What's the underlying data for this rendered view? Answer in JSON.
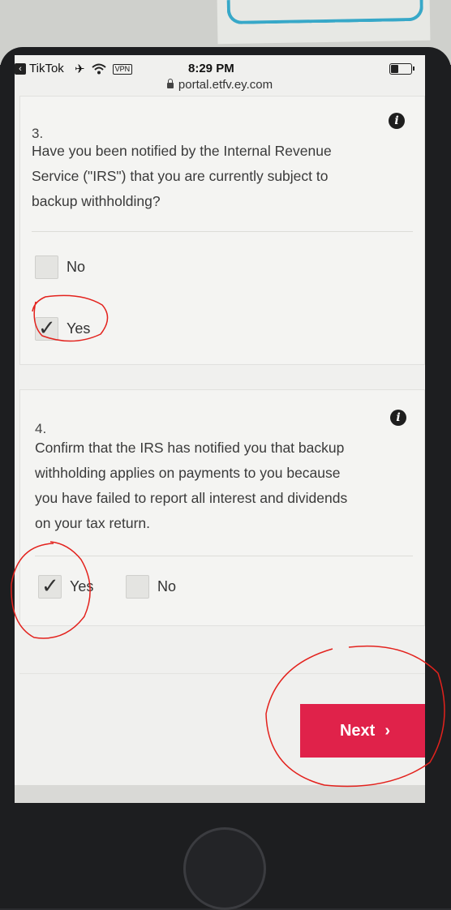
{
  "status_bar": {
    "back_app": "TikTok",
    "vpn": "VPN",
    "time": "8:29 PM"
  },
  "url": "portal.etfv.ey.com",
  "questions": [
    {
      "number": "3.",
      "text_lines": [
        "Have you been notified by the Internal Revenue",
        "Service (\"IRS\") that you are currently subject to",
        "backup withholding?"
      ],
      "options": [
        {
          "label": "No",
          "checked": false
        },
        {
          "label": "Yes",
          "checked": true
        }
      ]
    },
    {
      "number": "4.",
      "text_lines": [
        "Confirm that the IRS has notified you that backup",
        "withholding applies on payments to you because",
        "you have failed to report all interest and dividends",
        "on your tax return."
      ],
      "options": [
        {
          "label": "Yes",
          "checked": true
        },
        {
          "label": "No",
          "checked": false
        }
      ]
    }
  ],
  "next_button": {
    "label": "Next",
    "arrow": "›"
  },
  "colors": {
    "accent": "#e0224a",
    "annotation": "#e3221d"
  },
  "icons": [
    "airplane-icon",
    "wifi-icon",
    "lock-icon",
    "info-icon",
    "chevron-right-icon"
  ]
}
